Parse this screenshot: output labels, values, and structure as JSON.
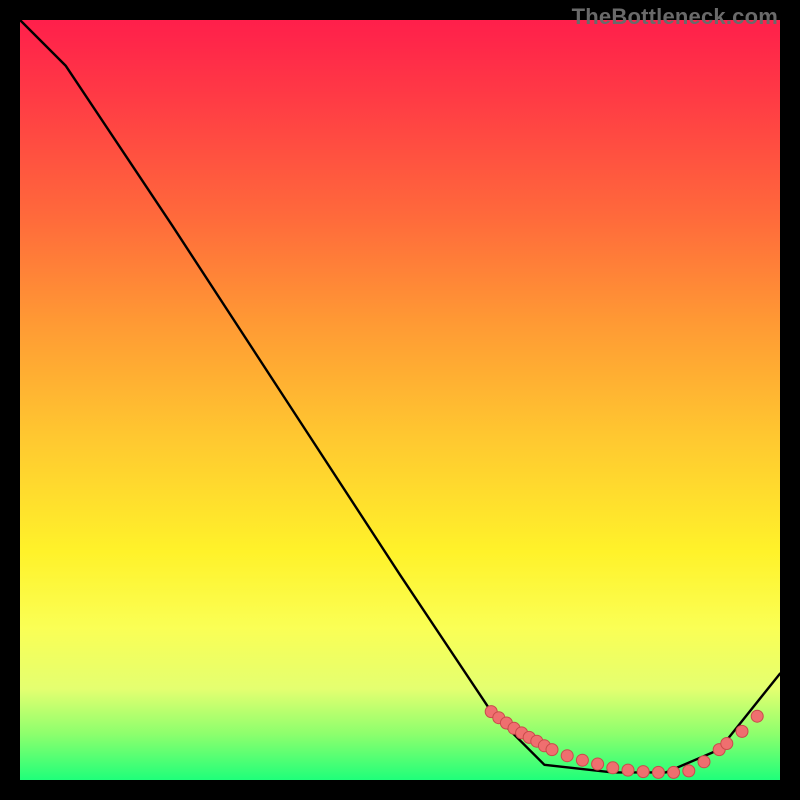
{
  "watermark": {
    "text": "TheBottleneck.com"
  },
  "chart_data": {
    "type": "line",
    "title": "",
    "xlabel": "",
    "ylabel": "",
    "xlim": [
      0,
      100
    ],
    "ylim": [
      0,
      100
    ],
    "series": [
      {
        "name": "bottleneck-curve",
        "color": "#000000",
        "x": [
          0,
          6,
          20,
          35,
          50,
          62,
          69,
          78,
          85,
          92,
          100
        ],
        "y": [
          100,
          94,
          73,
          50,
          27,
          9,
          2,
          1,
          1,
          4,
          14
        ]
      }
    ],
    "markers": {
      "name": "highlight-points",
      "color": "#ef6f6f",
      "stroke": "#c94b4b",
      "x": [
        62,
        63,
        64,
        65,
        66,
        67,
        68,
        69,
        70,
        72,
        74,
        76,
        78,
        80,
        82,
        84,
        86,
        88,
        90,
        92,
        93,
        95,
        97
      ],
      "y": [
        9,
        8.2,
        7.5,
        6.8,
        6.2,
        5.6,
        5.1,
        4.5,
        4.0,
        3.2,
        2.6,
        2.1,
        1.6,
        1.3,
        1.1,
        1.0,
        1.0,
        1.2,
        2.4,
        4.0,
        4.8,
        6.4,
        8.4
      ]
    }
  }
}
